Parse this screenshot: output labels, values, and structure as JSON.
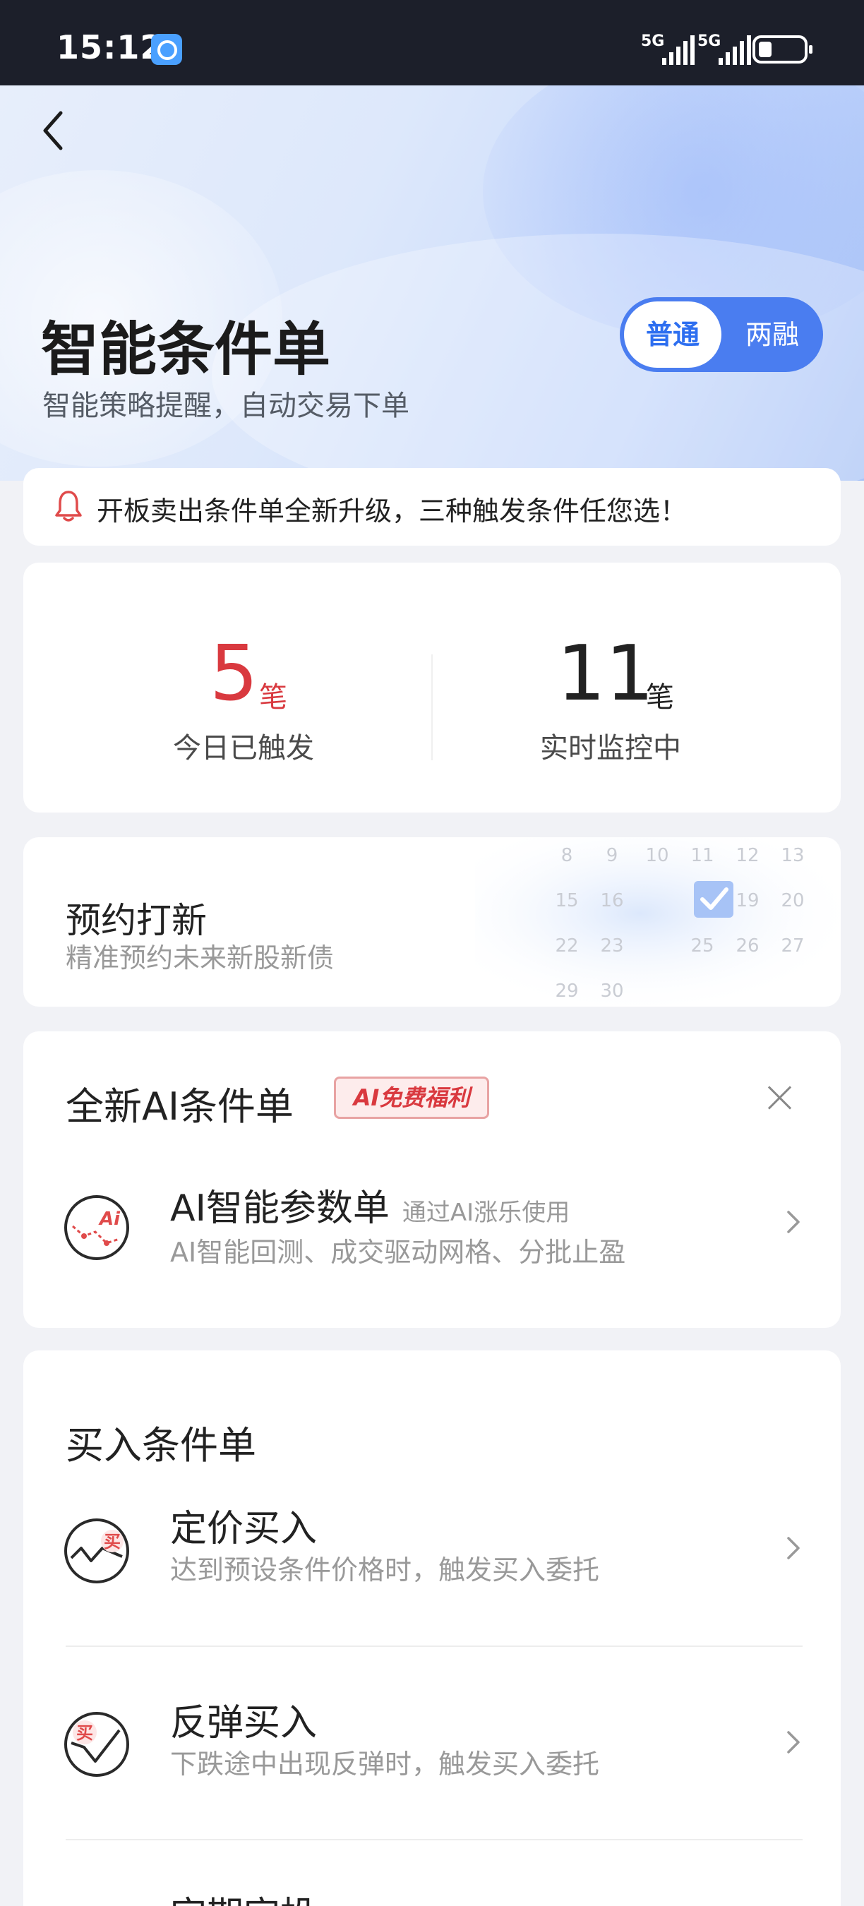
{
  "status_bar": {
    "time": "15:12",
    "signal1_label": "5G",
    "signal2_label": "5G"
  },
  "header": {
    "title": "智能条件单",
    "subtitle": "智能策略提醒，自动交易下单",
    "toggle": {
      "options": [
        "普通",
        "两融"
      ],
      "selected": "普通"
    }
  },
  "notice": {
    "text": "开板卖出条件单全新升级，三种触发条件任您选！"
  },
  "stats": {
    "triggered": {
      "value": "5",
      "unit": "笔",
      "label": "今日已触发"
    },
    "monitoring": {
      "value": "11",
      "unit": "笔",
      "label": "实时监控中"
    }
  },
  "ipo": {
    "title": "预约打新",
    "subtitle": "精准预约未来新股新债",
    "calendar_days": [
      "8",
      "9",
      "10",
      "11",
      "12",
      "13",
      "15",
      "16",
      "",
      "",
      "19",
      "20",
      "22",
      "23",
      "",
      "25",
      "26",
      "27",
      "29",
      "30"
    ]
  },
  "ai_section": {
    "title": "全新AI条件单",
    "badge": "AI免费福利",
    "item": {
      "title": "AI智能参数单",
      "hint": "通过AI涨乐使用",
      "desc": "AI智能回测、成交驱动网格、分批止盈",
      "icon_label": "Ai"
    }
  },
  "buy_section": {
    "title": "买入条件单",
    "items": [
      {
        "title": "定价买入",
        "desc": "达到预设条件价格时，触发买入委托",
        "icon_label": "买"
      },
      {
        "title": "反弹买入",
        "desc": "下跌途中出现反弹时，触发买入委托",
        "icon_label": "买"
      },
      {
        "title": "定期定投",
        "desc": "",
        "icon_label": ""
      }
    ]
  },
  "colors": {
    "accent_blue": "#4a7df0",
    "alert_red": "#d9393f",
    "status_bar_bg": "#1c1f2a"
  }
}
